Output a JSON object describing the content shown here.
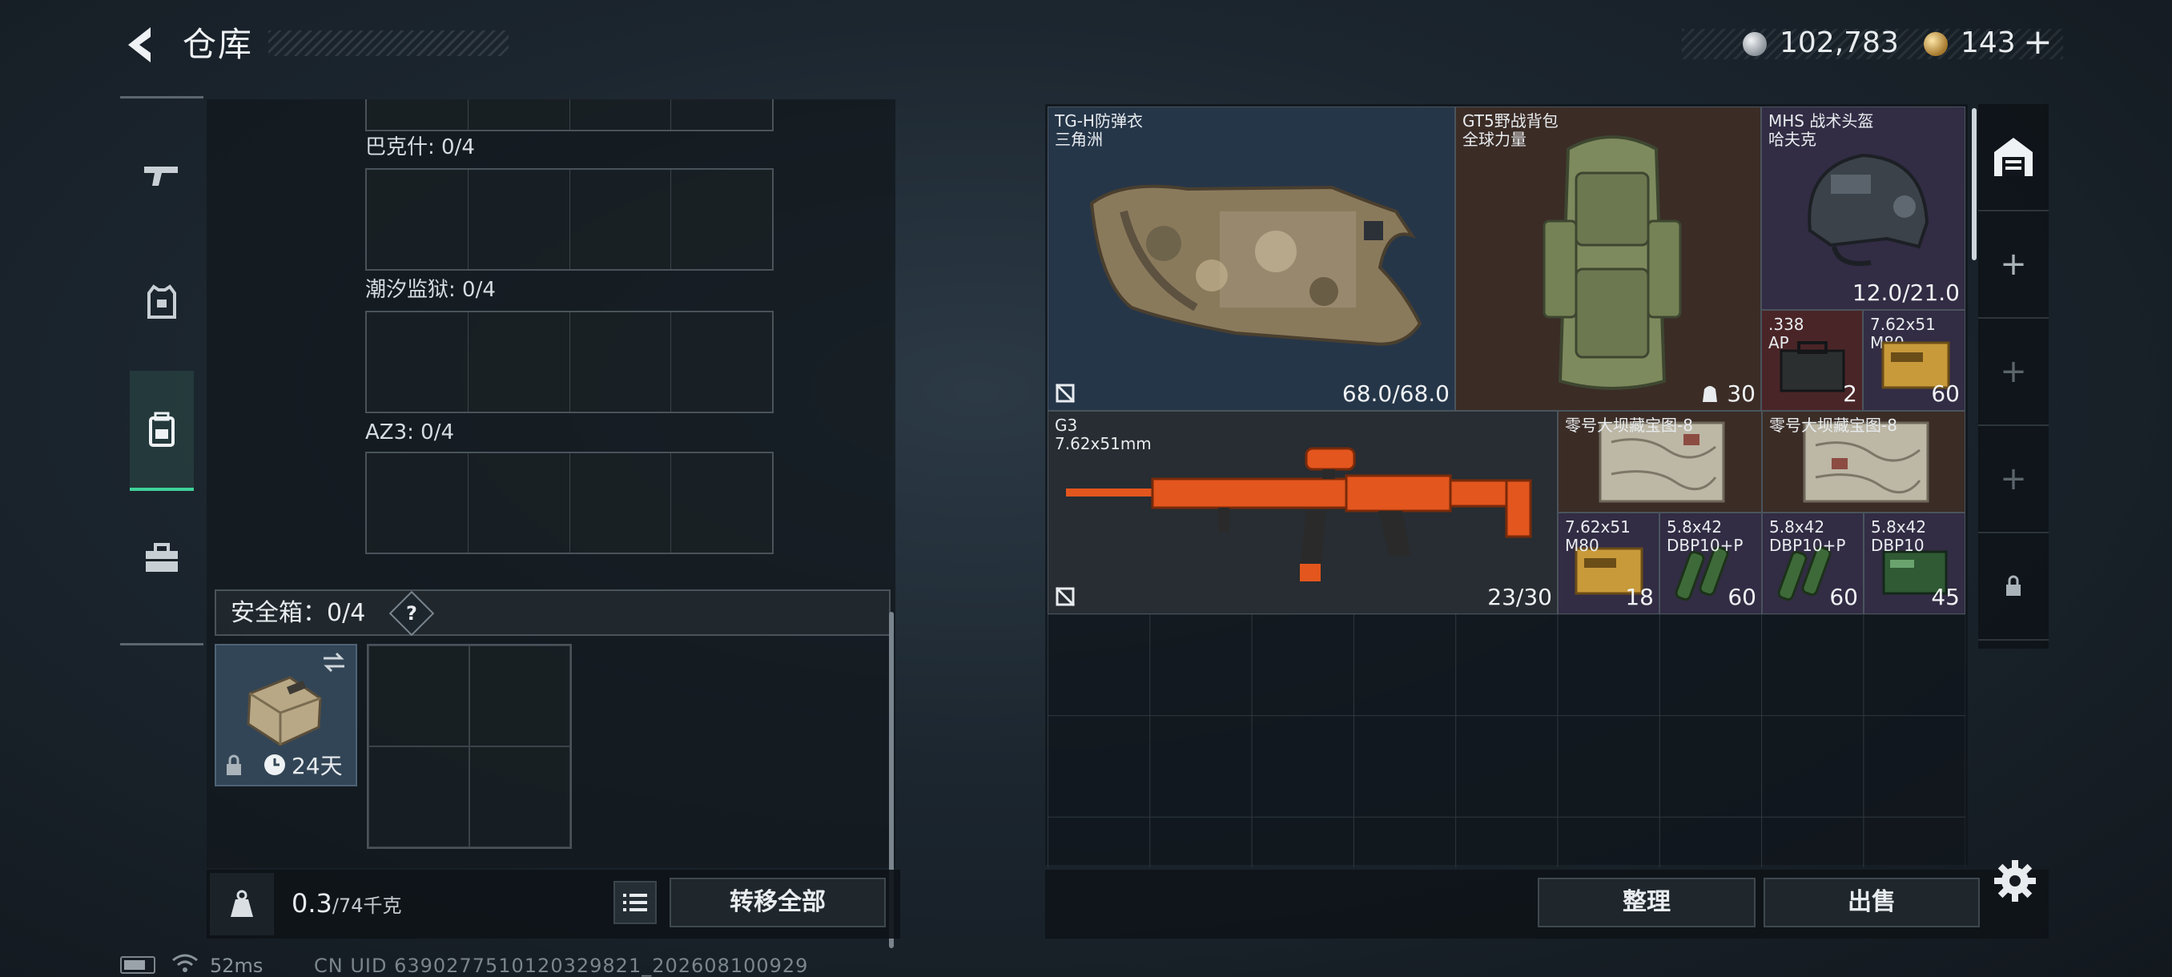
{
  "header": {
    "title": "仓库",
    "currency_silver": "102,783",
    "currency_gold": "143",
    "plus_label": "+"
  },
  "left_tabs": [
    {
      "name": "weapons",
      "icon": "pistol-icon"
    },
    {
      "name": "equipment",
      "icon": "vest-icon"
    },
    {
      "name": "containers",
      "icon": "backpack-icon",
      "active": true
    },
    {
      "name": "toolbox",
      "icon": "toolbox-icon"
    }
  ],
  "containers": {
    "slots": [
      {
        "label": "巴克什: 0/4"
      },
      {
        "label": "潮汐监狱: 0/4"
      },
      {
        "label": "AZ3: 0/4"
      }
    ],
    "safebox_label": "安全箱：0/4",
    "safebox_help": "?",
    "safebox_timer": "24天"
  },
  "weight": {
    "current": "0.3",
    "max": "/74千克"
  },
  "buttons": {
    "transfer_all": "转移全部",
    "sort": "整理",
    "sell": "出售"
  },
  "status": {
    "ping": "52ms",
    "uid": "CN UID 6390277510120329821_202608100929"
  },
  "inventory": {
    "items": [
      {
        "id": "vest",
        "name": "TG-H防弹衣\n三角洲",
        "value": "68.0/68.0",
        "rarity_color": "#263649",
        "icon": "armor-vest-icon"
      },
      {
        "id": "backpack",
        "name": "GT5野战背包\n全球力量",
        "value": "30",
        "rarity_color": "#3b2c26",
        "icon": "field-backpack-icon"
      },
      {
        "id": "helmet",
        "name": "MHS 战术头盔\n哈夫克",
        "value": "12.0/21.0",
        "rarity_color": "#322c44",
        "icon": "tactical-helmet-icon"
      },
      {
        "id": "ammo-338",
        "name": ".338\nAP",
        "value": "2",
        "rarity_color": "#4a2527",
        "icon": "ammo-box-icon"
      },
      {
        "id": "ammo-762-m80-a",
        "name": "7.62x51\nM80",
        "value": "60",
        "rarity_color": "#322c44",
        "icon": "ammo-crate-icon"
      },
      {
        "id": "rifle-g3",
        "name": "G3\n7.62x51mm",
        "value": "23/30",
        "rarity_color": "#272d32",
        "icon": "rifle-icon"
      },
      {
        "id": "map-1",
        "name": "零号大坝藏宝图-8",
        "value": "",
        "rarity_color": "#3b2c26",
        "icon": "map-icon"
      },
      {
        "id": "map-2",
        "name": "零号大坝藏宝图-8",
        "value": "",
        "rarity_color": "#3b2c26",
        "icon": "map-icon"
      },
      {
        "id": "ammo-762-m80-b",
        "name": "7.62x51\nM80",
        "value": "18",
        "rarity_color": "#322c44",
        "icon": "ammo-crate-icon"
      },
      {
        "id": "ammo-58-p-a",
        "name": "5.8x42\nDBP10+P",
        "value": "60",
        "rarity_color": "#322c44",
        "icon": "ammo-rounds-icon"
      },
      {
        "id": "ammo-58-p-b",
        "name": "5.8x42\nDBP10+P",
        "value": "60",
        "rarity_color": "#322c44",
        "icon": "ammo-rounds-icon"
      },
      {
        "id": "ammo-58",
        "name": "5.8x42\nDBP10",
        "value": "45",
        "rarity_color": "#322c44",
        "icon": "ammo-box-green-icon"
      }
    ]
  },
  "right_tabs": [
    {
      "icon": "warehouse-icon"
    },
    {
      "icon": "plus-icon",
      "label": "+"
    },
    {
      "icon": "plus-icon",
      "label": "+"
    },
    {
      "icon": "plus-icon",
      "label": "+"
    },
    {
      "icon": "lock-icon"
    }
  ]
}
